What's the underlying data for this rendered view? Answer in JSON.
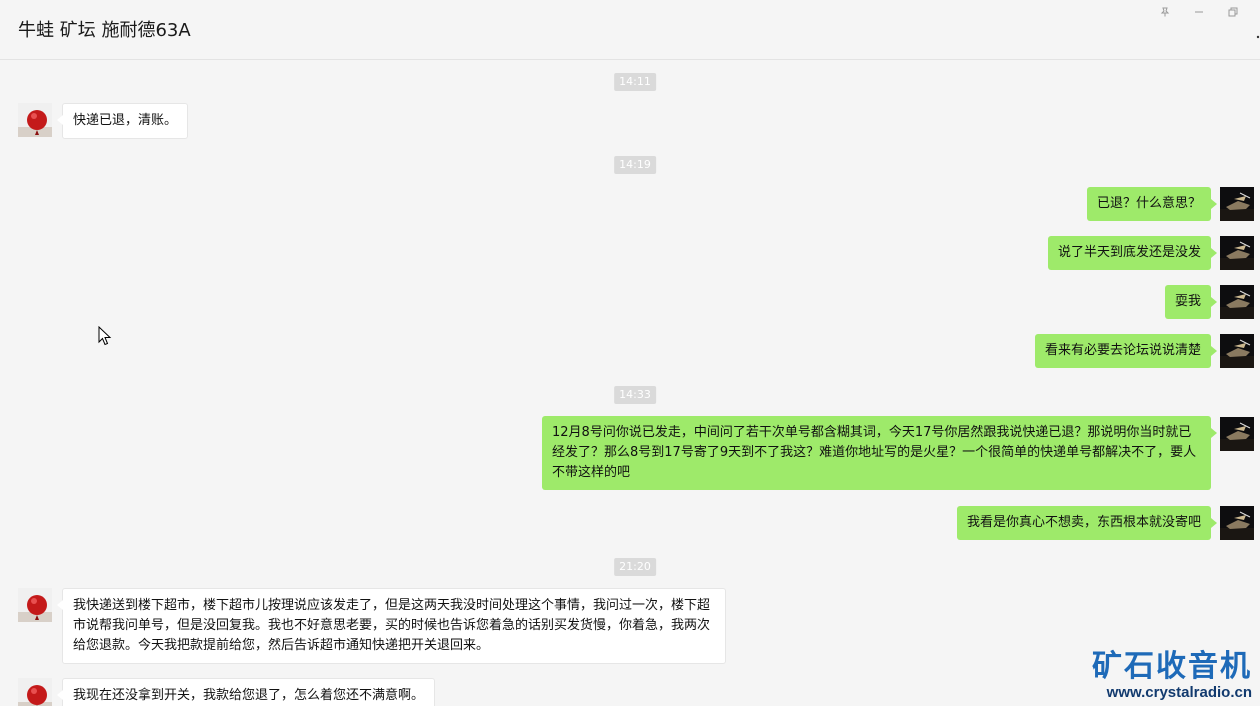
{
  "window": {
    "title": "牛蛙 矿坛 施耐德63A",
    "controls": {
      "pin_icon": "pin-icon",
      "minimize_icon": "minimize-icon",
      "restore_icon": "restore-icon"
    },
    "more_glyph": "..."
  },
  "colors": {
    "self_bubble": "#9eea6a",
    "other_bubble": "#ffffff",
    "background": "#f5f5f5",
    "timestamp_bg": "#dadada",
    "watermark_blue": "#1e6ab8"
  },
  "messages": {
    "t1": "14:11",
    "m1": "快递已退，清账。",
    "t2": "14:19",
    "m2": "已退？什么意思？",
    "m3": "说了半天到底发还是没发",
    "m4": "耍我",
    "m5": "看来有必要去论坛说说清楚",
    "t3": "14:33",
    "m6": "12月8号问你说已发走，中间问了若干次单号都含糊其词，今天17号你居然跟我说快递已退？那说明你当时就已经发了？那么8号到17号寄了9天到不了我这？难道你地址写的是火星？一个很简单的快递单号都解决不了，要人不带这样的吧",
    "m7": "我看是你真心不想卖，东西根本就没寄吧",
    "t4": "21:20",
    "m8": "我快递送到楼下超市，楼下超市儿按理说应该发走了，但是这两天我没时间处理这个事情，我问过一次，楼下超市说帮我问单号，但是没回复我。我也不好意思老要，买的时候也告诉您着急的话别买发货慢，你着急，我两次给您退款。今天我把款提前给您，然后告诉超市通知快递把开关退回来。",
    "m9": "我现在还没拿到开关，我款给您退了，怎么着您还不满意啊。"
  },
  "watermark": {
    "title": "矿石收音机",
    "url": "www.crystalradio.cn"
  }
}
